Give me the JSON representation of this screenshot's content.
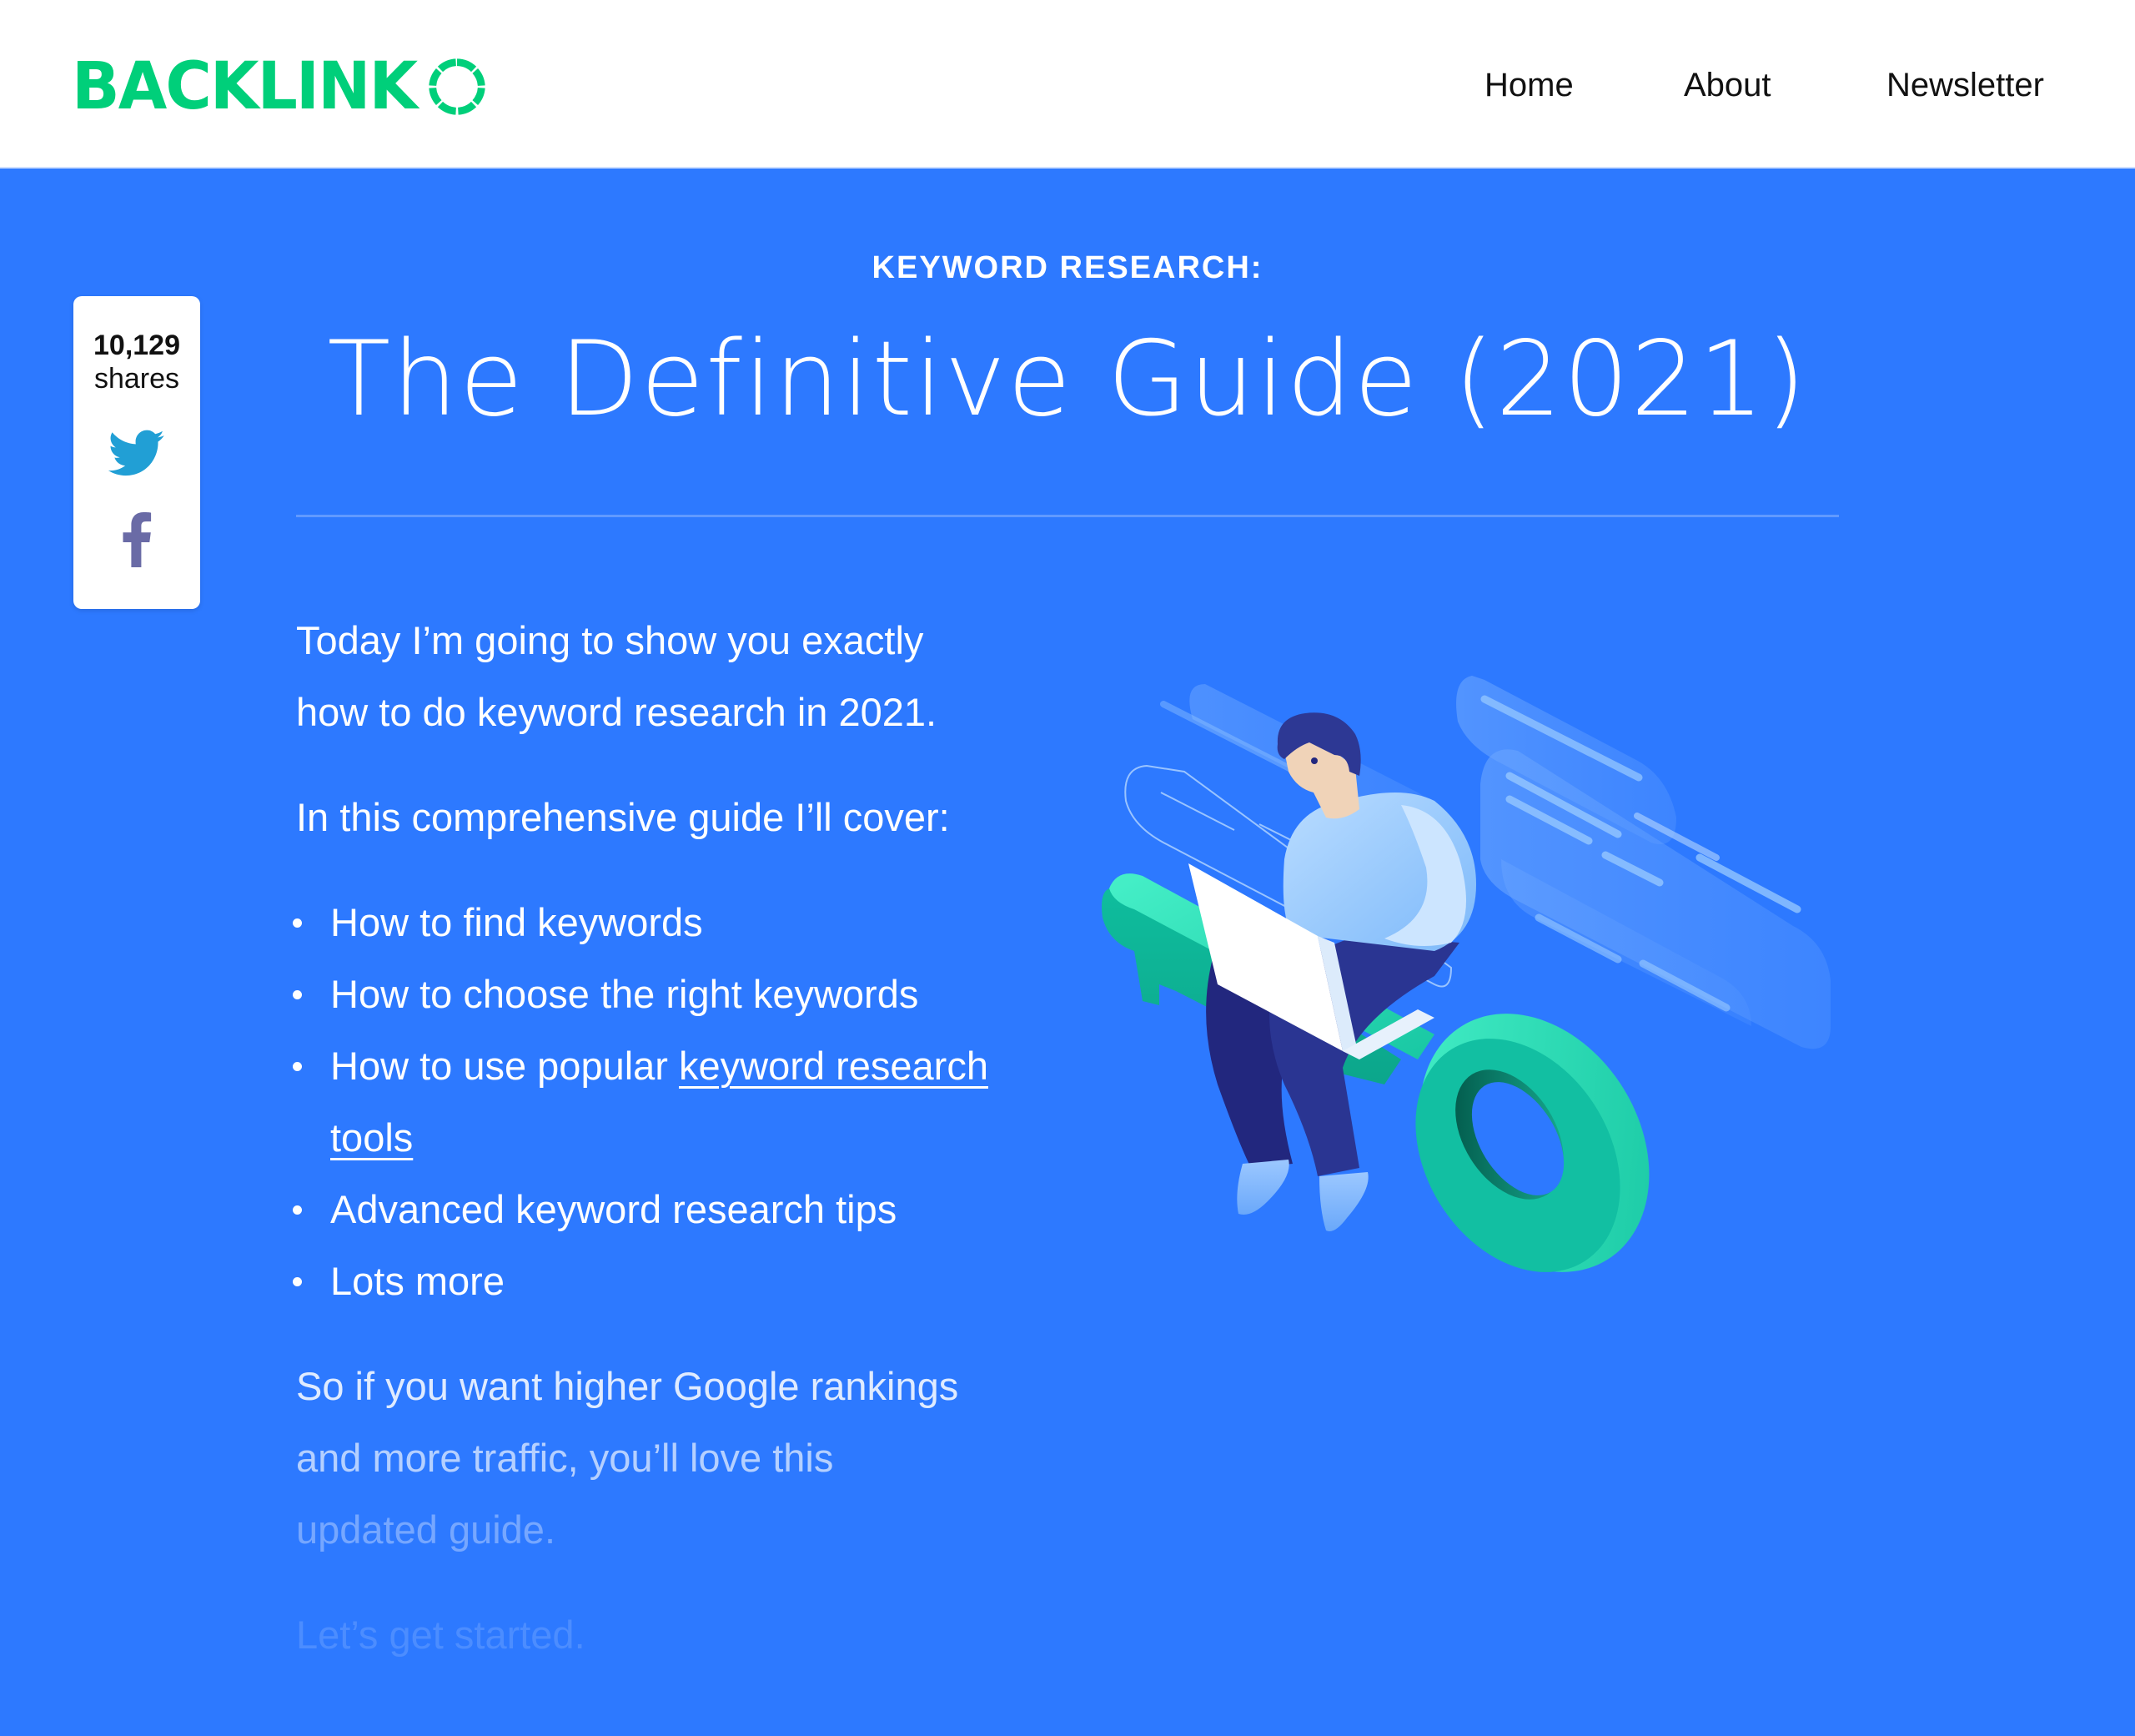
{
  "header": {
    "logo_text": "BACKLINK",
    "logo_icon": "ring-o-icon",
    "nav": [
      {
        "label": "Home"
      },
      {
        "label": "About"
      },
      {
        "label": "Newsletter"
      }
    ]
  },
  "share": {
    "count": "10,129",
    "label": "shares",
    "icons": [
      "twitter-icon",
      "facebook-icon"
    ]
  },
  "hero": {
    "kicker": "KEYWORD RESEARCH:",
    "title": "The Definitive Guide (2021)"
  },
  "content": {
    "intro_line1": "Today I’m going to show you exactly",
    "intro_line2": "how to do keyword research in 2021.",
    "cover_intro": "In this comprehensive guide I’ll cover:",
    "bullets": [
      {
        "text": "How to find keywords"
      },
      {
        "text": "How to choose the right keywords"
      },
      {
        "text": "How to use popular ",
        "link": "keyword research tools"
      },
      {
        "text": "Advanced keyword research tips"
      },
      {
        "text": "Lots more"
      }
    ],
    "closing_line1": "So if you want higher Google rankings",
    "closing_line2": "and more traffic, you’ll love this",
    "closing_line3": "updated guide.",
    "start": "Let’s get started."
  },
  "colors": {
    "brand_green": "#00CF7A",
    "hero_blue": "#2D79FF",
    "twitter": "#1DA1F2",
    "facebook": "#6A6BA6"
  }
}
